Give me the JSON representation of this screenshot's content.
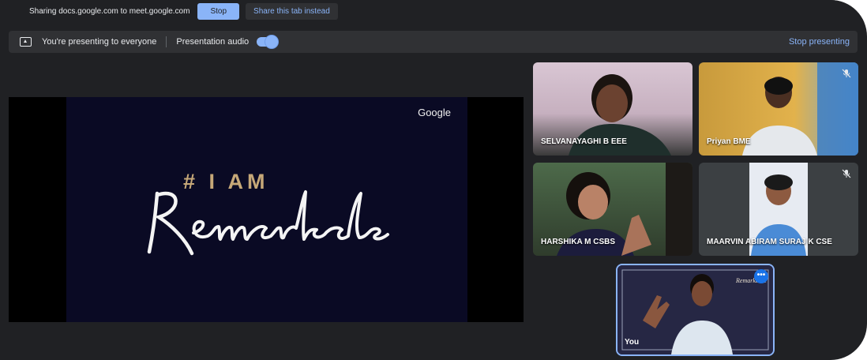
{
  "share_bar": {
    "text": "Sharing docs.google.com to meet.google.com",
    "stop_label": "Stop",
    "share_tab_label": "Share this tab instead"
  },
  "present_bar": {
    "presenting_text": "You're presenting to everyone",
    "audio_label": "Presentation audio",
    "audio_on": true,
    "stop_label": "Stop presenting"
  },
  "slide": {
    "brand": "Google",
    "headline": "# I AM",
    "script_word": "Remarkable",
    "colors": {
      "background": "#0a0a24",
      "accent": "#c6a878"
    }
  },
  "participants": [
    {
      "name": "SELVANAYAGHI B EEE",
      "muted": false
    },
    {
      "name": "Priyan BME",
      "muted": true
    },
    {
      "name": "HARSHIKA M CSBS",
      "muted": false
    },
    {
      "name": "MAARVIN ABIRAM SURAJ K CSE",
      "muted": true
    }
  ],
  "self_tile": {
    "name": "You",
    "menu_icon": "more-horizontal-icon"
  },
  "colors": {
    "accent": "#8ab4f8",
    "surface": "#202124",
    "tile": "#3c4043"
  }
}
